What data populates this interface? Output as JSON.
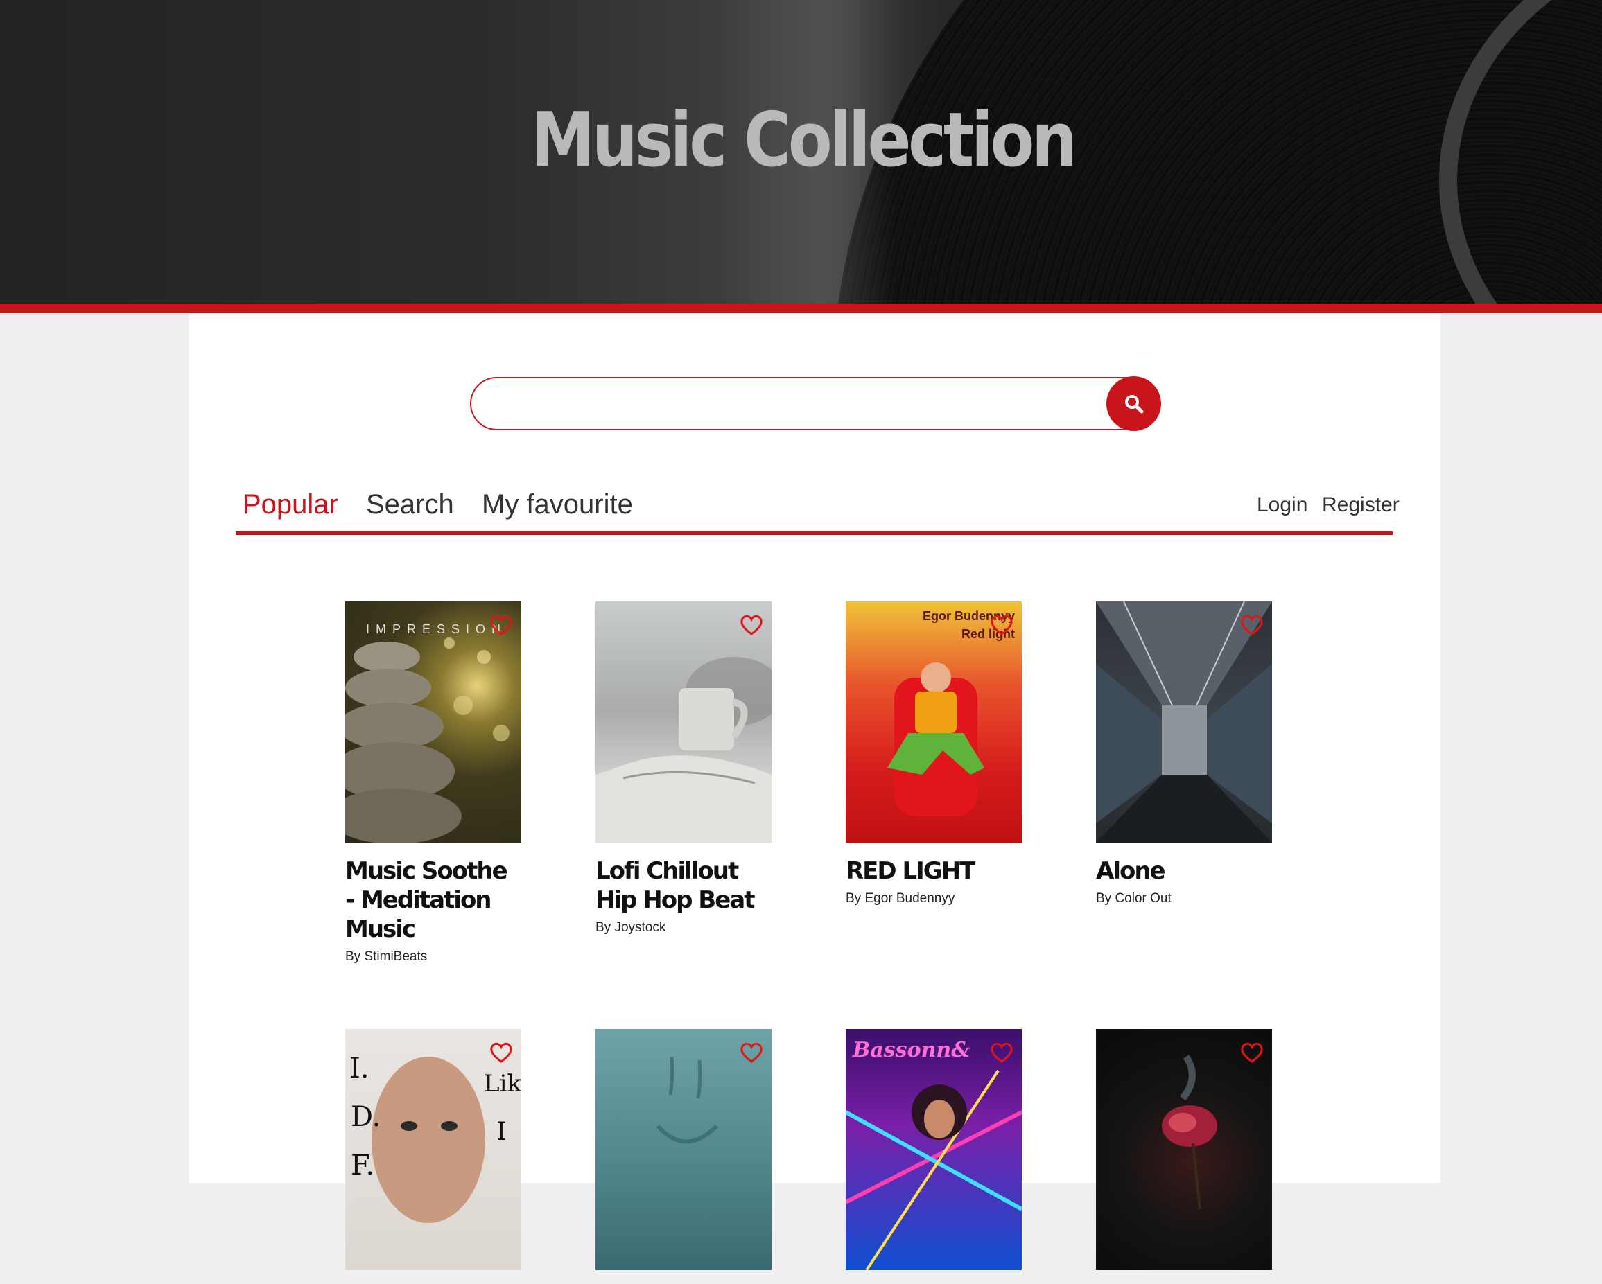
{
  "header": {
    "title": "Music Collection"
  },
  "search": {
    "value": "",
    "placeholder": ""
  },
  "tabs": [
    {
      "label": "Popular",
      "active": true
    },
    {
      "label": "Search",
      "active": false
    },
    {
      "label": "My favourite",
      "active": false
    }
  ],
  "auth": {
    "login": "Login",
    "register": "Register"
  },
  "albums": [
    {
      "title": "Music Soothe - Meditation Music",
      "artist": "By StimiBeats",
      "cover_text": "IMPRESSION"
    },
    {
      "title": "Lofi Chillout Hip Hop Beat",
      "artist": "By Joystock"
    },
    {
      "title": "RED LIGHT",
      "artist": "By Egor Budennyy",
      "cover_text": "Egor Budennyy Red light"
    },
    {
      "title": "Alone",
      "artist": "By Color Out"
    },
    {
      "title": "",
      "artist": ""
    },
    {
      "title": "",
      "artist": ""
    },
    {
      "title": "",
      "artist": ""
    },
    {
      "title": "",
      "artist": ""
    }
  ],
  "colors": {
    "accent": "#c8141a",
    "heart": "#e0141a"
  },
  "icons": {
    "search": "search-icon",
    "favourite": "heart-icon"
  }
}
